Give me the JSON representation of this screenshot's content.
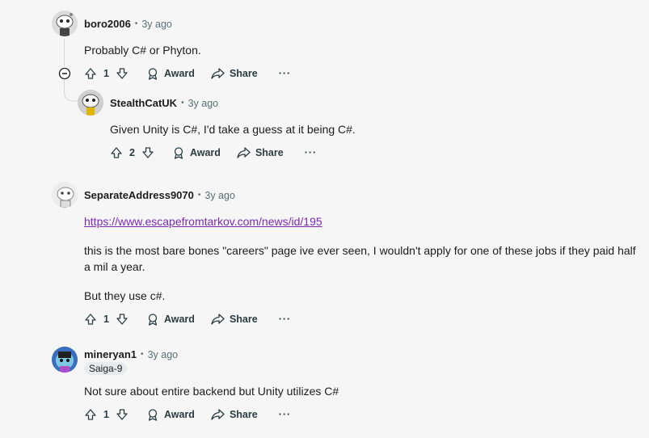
{
  "actions": {
    "award": "Award",
    "share": "Share",
    "more": "···"
  },
  "comments": [
    {
      "user": "boro2006",
      "time": "3y ago",
      "text": "Probably C# or Phyton.",
      "votes": "1"
    },
    {
      "user": "StealthCatUK",
      "time": "3y ago",
      "text": "Given Unity is C#, I'd take a guess at it being C#.",
      "votes": "2"
    },
    {
      "user": "SeparateAddress9070",
      "time": "3y ago",
      "link": "https://www.escapefromtarkov.com/news/id/195",
      "text": "this is the most bare bones \"careers\" page ive ever seen, I wouldn't apply for one of these jobs if they paid half a mil a year.",
      "text2": "But they use c#.",
      "votes": "1"
    },
    {
      "user": "mineryan1",
      "time": "3y ago",
      "flair": "Saiga-9",
      "text": "Not sure about entire backend but Unity utilizes C#",
      "votes": "1"
    }
  ],
  "colors": {
    "background": "#f6f6f6",
    "link": "#7d2ab4",
    "meta": "#576f76"
  }
}
